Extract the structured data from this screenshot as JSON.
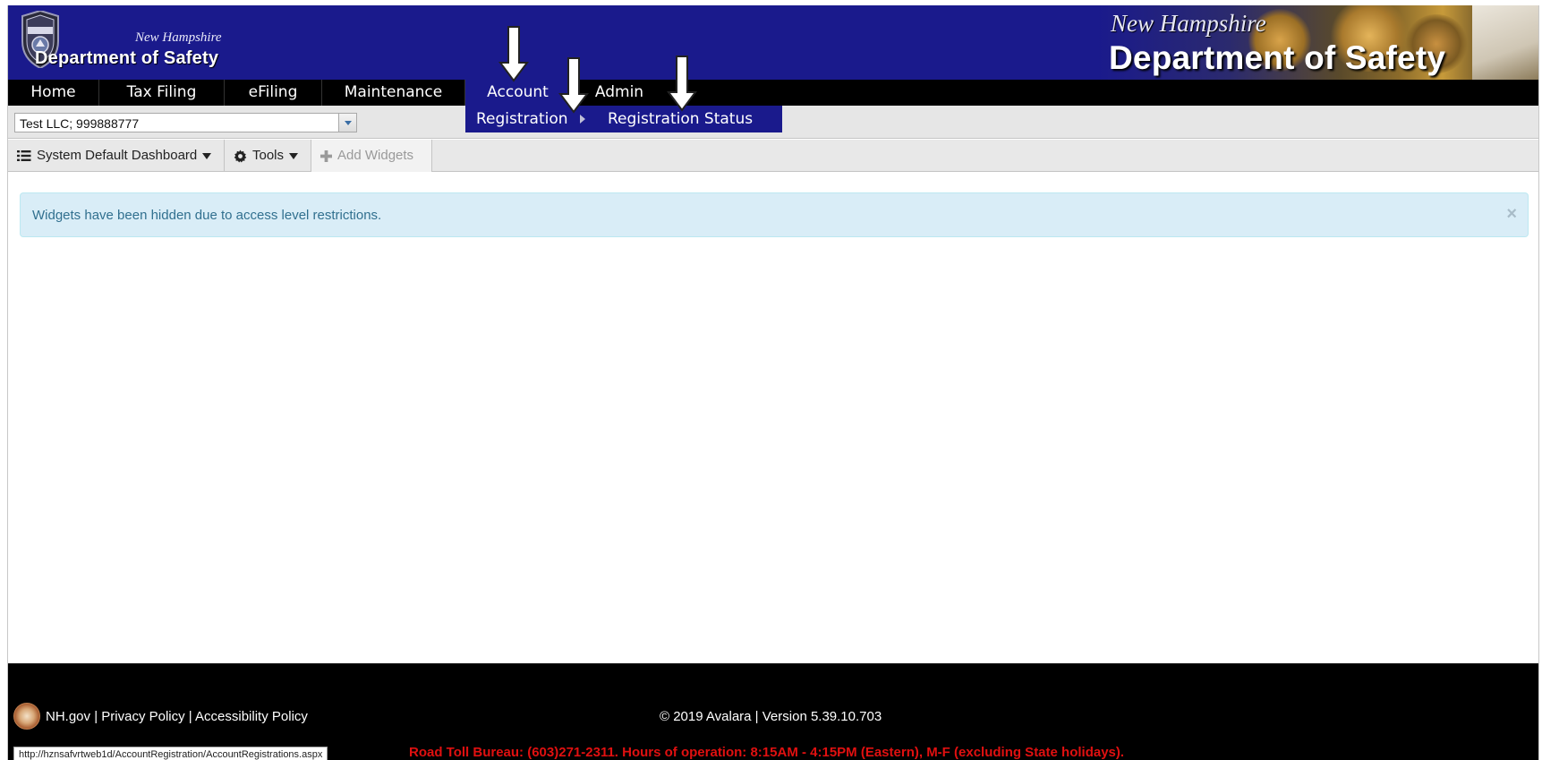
{
  "header": {
    "logo_state": "New Hampshire",
    "logo_dept": "Department of Safety",
    "banner_state": "New Hampshire",
    "banner_dept": "Department of Safety"
  },
  "nav": {
    "items": [
      {
        "label": "Home"
      },
      {
        "label": "Tax Filing"
      },
      {
        "label": "eFiling"
      },
      {
        "label": "Maintenance"
      },
      {
        "label": "Account"
      },
      {
        "label": "Admin"
      }
    ],
    "active": "Account",
    "submenu": {
      "registration": "Registration",
      "registration_status": "Registration Status"
    }
  },
  "account_select": {
    "value": "Test LLC; 999888777"
  },
  "toolbar": {
    "dashboard_label": "System Default Dashboard",
    "tools_label": "Tools",
    "add_widgets_label": "Add Widgets"
  },
  "alert": {
    "message": "Widgets have been hidden due to access level restrictions.",
    "close": "×"
  },
  "footer": {
    "nh_gov": "NH.gov",
    "privacy": "Privacy Policy",
    "accessibility": "Accessibility Policy",
    "separator": " | ",
    "copyright": "© 2019 Avalara | Version 5.39.10.703",
    "road_toll": "Road Toll Bureau: (603)271-2311. Hours of operation: 8:15AM - 4:15PM (Eastern), M-F (excluding State holidays)."
  },
  "status_url": "http://hznsafvrtweb1d/AccountRegistration/AccountRegistrations.aspx",
  "colors": {
    "brand_navy": "#1a1a8c",
    "nav_black": "#000000",
    "alert_bg": "#d9edf7",
    "alert_text": "#31708f",
    "road_toll_red": "#e01010"
  }
}
